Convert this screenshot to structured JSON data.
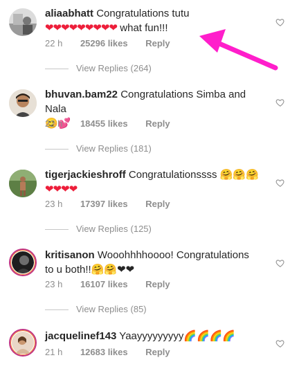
{
  "comments": [
    {
      "username": "aliaabhatt",
      "text": "Congratulations tutu",
      "emoji_line": "❤❤❤❤❤❤❤❤❤",
      "text2": " what fun!!!",
      "time": "22 h",
      "likes": "25296 likes",
      "reply": "Reply",
      "view_replies": "View Replies (264)"
    },
    {
      "username": "bhuvan.bam22",
      "text": "Congratulations Simba and Nala",
      "emoji_line": "😊💕",
      "time": "22 h",
      "likes": "18455 likes",
      "reply": "Reply",
      "view_replies": "View Replies (181)"
    },
    {
      "username": "tigerjackieshroff",
      "text": "Congratulationssss 🤗🤗🤗",
      "emoji_line": "❤❤❤❤",
      "time": "23 h",
      "likes": "17397 likes",
      "reply": "Reply",
      "view_replies": "View Replies (125)"
    },
    {
      "username": "kritisanon",
      "text": "Wooohhhhoooo! Congratulations to u both!!🤗🤗❤❤",
      "time": "23 h",
      "likes": "16107 likes",
      "reply": "Reply",
      "view_replies": "View Replies (85)"
    },
    {
      "username": "jacquelinef143",
      "text": "Yaayyyyyyyyy🌈🌈🌈🌈",
      "time": "21 h",
      "likes": "12683 likes",
      "reply": "Reply"
    }
  ],
  "colors": {
    "arrow": "#ff1ecb",
    "heart_emoji": "#ed1e3a",
    "meta": "#8e8e8e"
  },
  "icons": {
    "like": "heart-outline-icon"
  }
}
